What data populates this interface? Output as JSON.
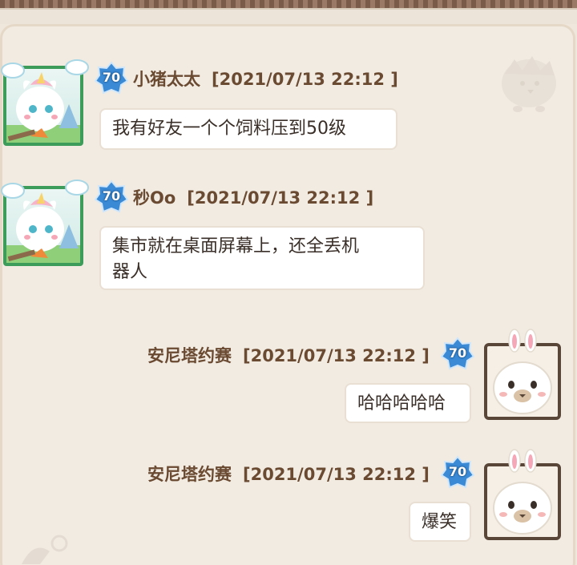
{
  "messages": [
    {
      "sender": "小猪太太",
      "timestamp": "[2021/07/13 22:12 ]",
      "level": "70",
      "text": "我有好友一个个饲料压到50级",
      "side": "left",
      "avatar": "unicorn-cat-avatar"
    },
    {
      "sender": "秒Oo",
      "timestamp": "[2021/07/13 22:12 ]",
      "level": "70",
      "text_lines": [
        "集市就在桌面屏幕上，还全丢机",
        "器人"
      ],
      "side": "left",
      "avatar": "unicorn-cat-avatar"
    },
    {
      "sender": "安尼塔约赛",
      "timestamp": "[2021/07/13 22:12 ]",
      "level": "70",
      "text": "哈哈哈哈哈",
      "side": "right",
      "avatar": "alpaca-bunny-avatar"
    },
    {
      "sender": "安尼塔约赛",
      "timestamp": "[2021/07/13 22:12 ]",
      "level": "70",
      "text": "爆笑",
      "side": "right",
      "avatar": "alpaca-bunny-avatar"
    }
  ],
  "colors": {
    "name_text": "#6b4a32",
    "bubble_bg": "#ffffff",
    "badge_blue": "#3a8ad6",
    "panel_bg": "#f1ebe2"
  }
}
